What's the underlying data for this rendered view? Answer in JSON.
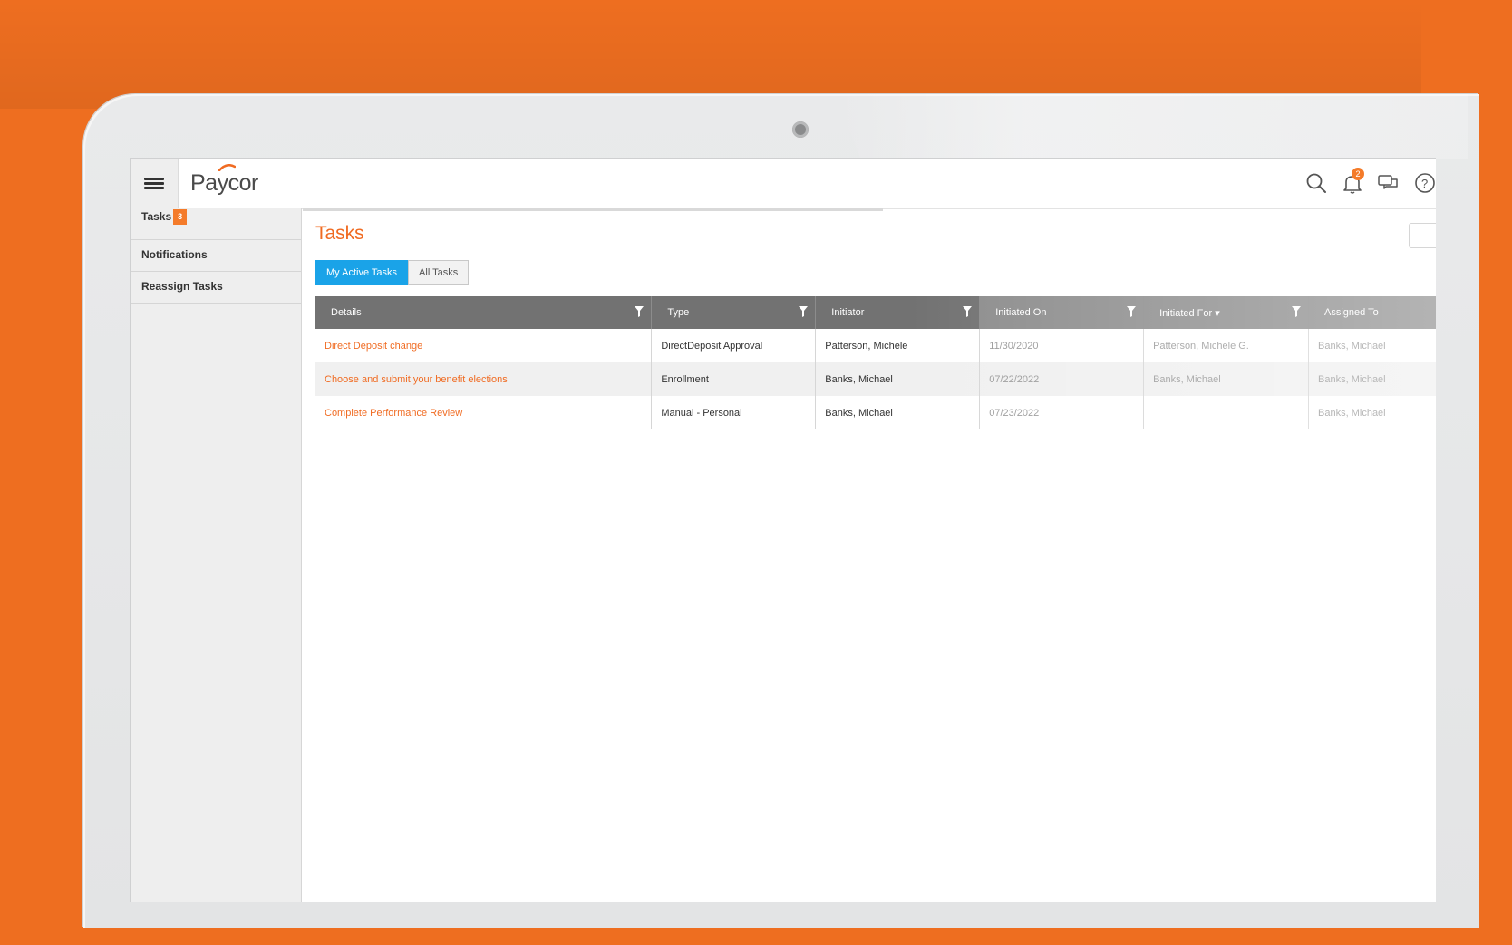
{
  "app": {
    "logo": "Paycor"
  },
  "topbar": {
    "notification_count": "2",
    "icons": [
      "menu-icon",
      "search-icon",
      "bell-icon",
      "chat-icon",
      "help-icon"
    ]
  },
  "sidebar": {
    "items": [
      {
        "label": "Tasks",
        "badge": "3"
      },
      {
        "label": "Notifications"
      },
      {
        "label": "Reassign Tasks"
      }
    ]
  },
  "main": {
    "title": "Tasks",
    "tabs": [
      {
        "label": "My Active Tasks",
        "active": true
      },
      {
        "label": "All Tasks",
        "active": false
      }
    ],
    "table": {
      "columns": [
        "Details",
        "Type",
        "Initiator",
        "Initiated On",
        "Initiated For ▾",
        "Assigned To"
      ],
      "rows": [
        [
          "Direct Deposit change",
          "DirectDeposit Approval",
          "Patterson, Michele",
          "11/30/2020",
          "Patterson, Michele G.",
          "Banks, Michael"
        ],
        [
          "Choose and submit your benefit elections",
          "Enrollment",
          "Banks, Michael",
          "07/22/2022",
          "Banks, Michael",
          "Banks, Michael"
        ],
        [
          "Complete Performance Review",
          "Manual - Personal",
          "Banks, Michael",
          "07/23/2022",
          "",
          "Banks, Michael"
        ]
      ]
    }
  },
  "colors": {
    "background": "#ee6e20",
    "accent": "#f06b22",
    "active_tab": "#1aa3e8",
    "header": "#727272"
  }
}
